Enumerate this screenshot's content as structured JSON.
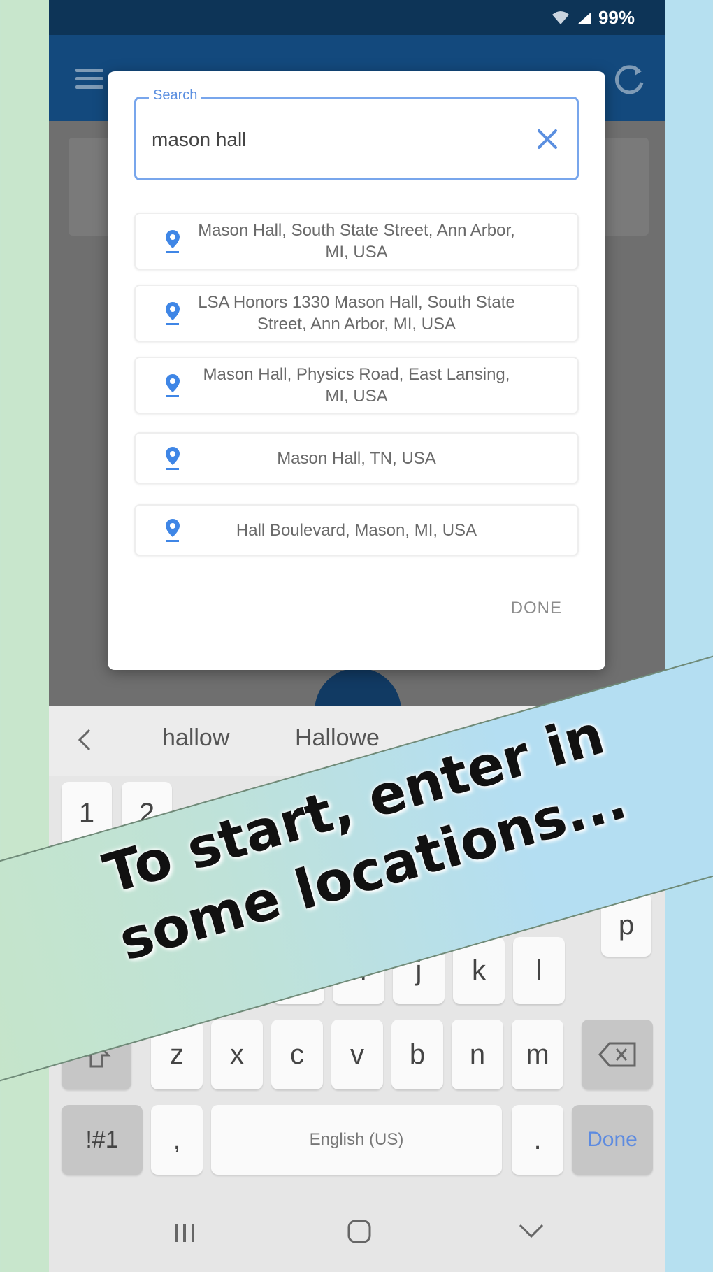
{
  "status_bar": {
    "battery": "99%"
  },
  "search_dialog": {
    "label": "Search",
    "value": "mason hall",
    "suggestions": [
      "Mason Hall, South State Street, Ann Arbor, MI, USA",
      "LSA Honors 1330 Mason Hall, South State Street, Ann Arbor, MI, USA",
      "Mason Hall, Physics Road, East Lansing, MI, USA",
      "Mason Hall, TN, USA",
      "Hall Boulevard, Mason, MI, USA"
    ],
    "done_label": "DONE"
  },
  "suggest_bar": {
    "words": [
      "hallow",
      "Hallowe"
    ]
  },
  "keyboard": {
    "row1": [
      "1",
      "2"
    ],
    "row_partial": [
      "p"
    ],
    "row3": [
      "g",
      "h",
      "j",
      "k",
      "l"
    ],
    "row4": [
      "z",
      "x",
      "c",
      "v",
      "b",
      "n",
      "m"
    ],
    "symbols_label": "!#1",
    "comma": ",",
    "space_label": "English (US)",
    "period": ".",
    "done_label": "Done"
  },
  "banner": {
    "line1": "To start, enter in",
    "line2": "some locations..."
  },
  "colors": {
    "appbar": "#13497d",
    "statusbar": "#0d3457",
    "accent": "#5b8fe0"
  }
}
